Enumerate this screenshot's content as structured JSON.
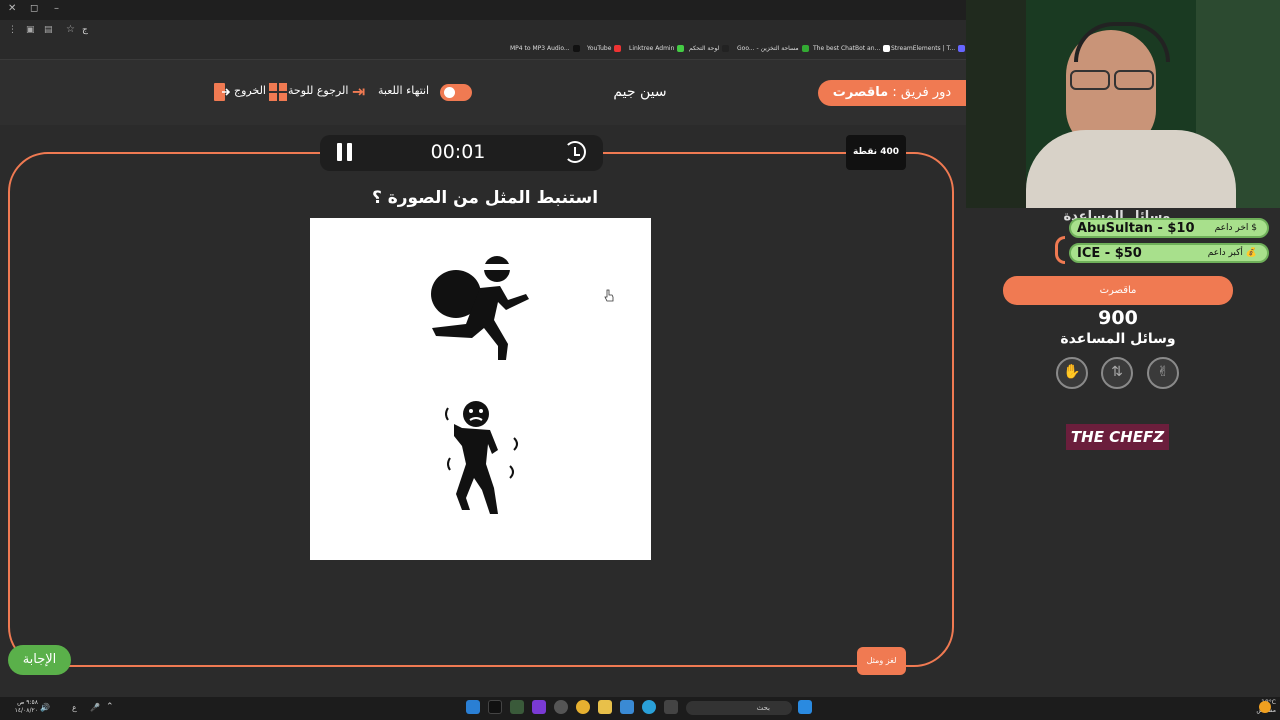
{
  "browser": {
    "address": "ج",
    "bookmarks": [
      "MP4 to MP3 Audio...",
      "YouTube",
      "Linktree Admin",
      "لوحة التحكم",
      "Goo... - مساحة التخزين",
      "The best ChatBot an...",
      "StreamElements | T..."
    ]
  },
  "header": {
    "turn_prefix": "دور فريق :",
    "turn_team": "ماقصرت",
    "game_title": "سين جيم",
    "end_game_label": "انتهاء اللعبة",
    "back_to_board_label": "الرجوع للوحة",
    "exit_label": "الخروج"
  },
  "board": {
    "timer": "00:01",
    "points": "400 نقطة",
    "question": "استنبط المثل من الصورة ؟",
    "answer_label": "الإجابة",
    "hint_label": "لغز ومثل"
  },
  "sidebar": {
    "ghost_label": "وسائل المساعدة",
    "last_supporter_label": "$ اخر داعم",
    "last_supporter_value": "AbuSultan - $10",
    "top_supporter_label": "💰 أكبر داعم",
    "top_supporter_value": "ICE - $50",
    "team_name": "ماقصرت",
    "score": "900",
    "helpers_label": "وسائل المساعدة",
    "helpers": [
      "✋",
      "⇅",
      "✌"
    ],
    "sponsor_logo": "THE CHEFZ"
  },
  "taskbar": {
    "search_placeholder": "بحث",
    "time": "٩:٥٨ ص",
    "date": "١٤/٠٨/٢٠",
    "temperature": "18°C",
    "weather_text": "مشمس"
  },
  "colors": {
    "accent": "#f07a52",
    "answer": "#5ab04a",
    "pill": "#a8e08c"
  }
}
